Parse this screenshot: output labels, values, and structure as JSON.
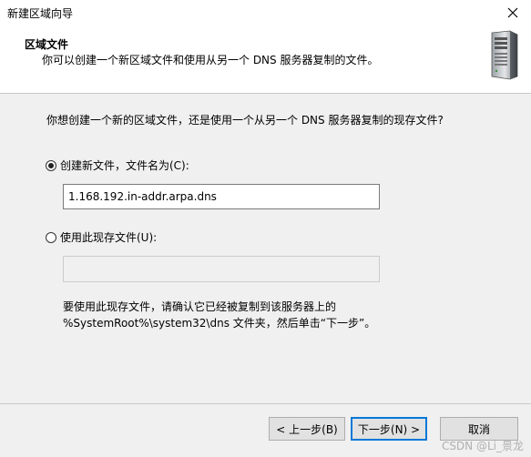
{
  "window": {
    "title": "新建区域向导"
  },
  "header": {
    "title": "区域文件",
    "subtitle": "你可以创建一个新区域文件和使用从另一个 DNS 服务器复制的文件。",
    "icon": "server-icon"
  },
  "content": {
    "question": "你想创建一个新的区域文件，还是使用一个从另一个 DNS 服务器复制的现存文件?",
    "option_new": {
      "label": "创建新文件，文件名为(C):",
      "selected": true,
      "value": "1.168.192.in-addr.arpa.dns"
    },
    "option_existing": {
      "label": "使用此现存文件(U):",
      "selected": false,
      "value": ""
    },
    "hint_line1": "要使用此现存文件，请确认它已经被复制到该服务器上的",
    "hint_line2": "%SystemRoot%\\system32\\dns 文件夹，然后单击“下一步”。"
  },
  "buttons": {
    "back": "< 上一步(B)",
    "next": "下一步(N) >",
    "cancel": "取消"
  },
  "watermark": "CSDN @Li_景龙"
}
